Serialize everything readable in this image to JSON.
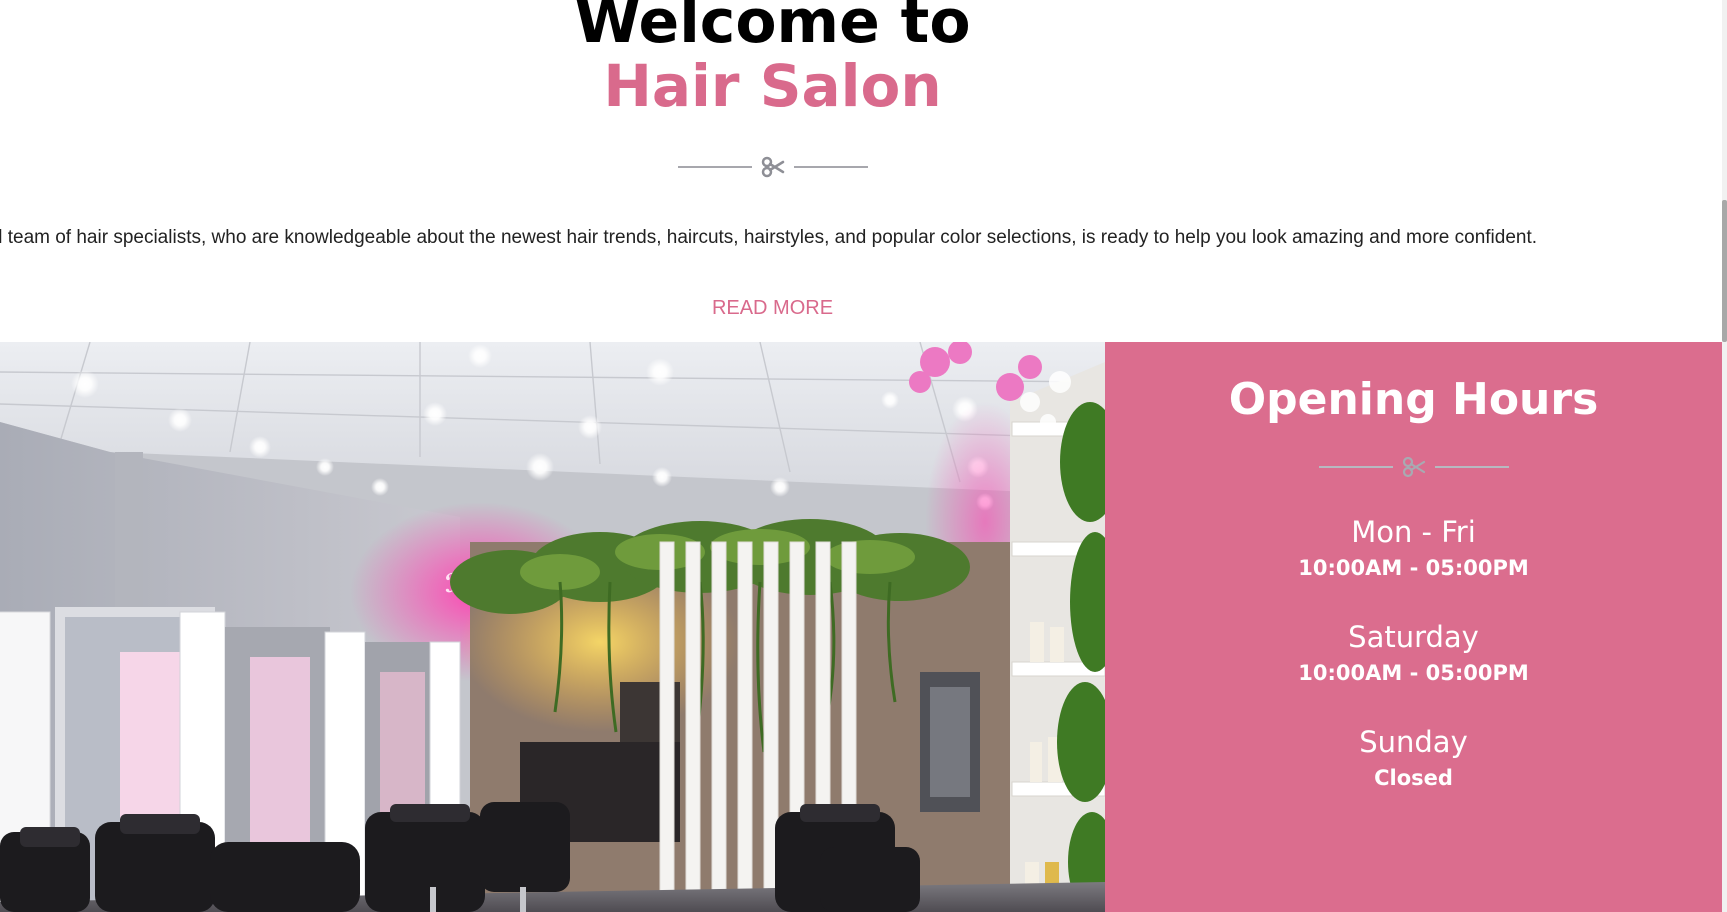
{
  "welcome": {
    "title": "Welcome to",
    "subtitle": "Hair Salon",
    "intro": "ll team of hair specialists, who are knowledgeable about the newest hair trends, haircuts, hairstyles, and popular color selections, is ready to help you look amazing and more confident.",
    "read_more_label": "READ MORE"
  },
  "divider_icon": "scissors-icon",
  "opening_hours": {
    "title": "Opening Hours",
    "schedule": [
      {
        "day": "Mon - Fri",
        "time": "10:00AM - 05:00PM"
      },
      {
        "day": "Saturday",
        "time": "10:00AM - 05:00PM"
      },
      {
        "day": "Sunday",
        "time": "Closed"
      }
    ]
  },
  "colors": {
    "accent": "#db6d8e",
    "title_pink": "#d96a8c",
    "divider": "#a7a7ad"
  }
}
